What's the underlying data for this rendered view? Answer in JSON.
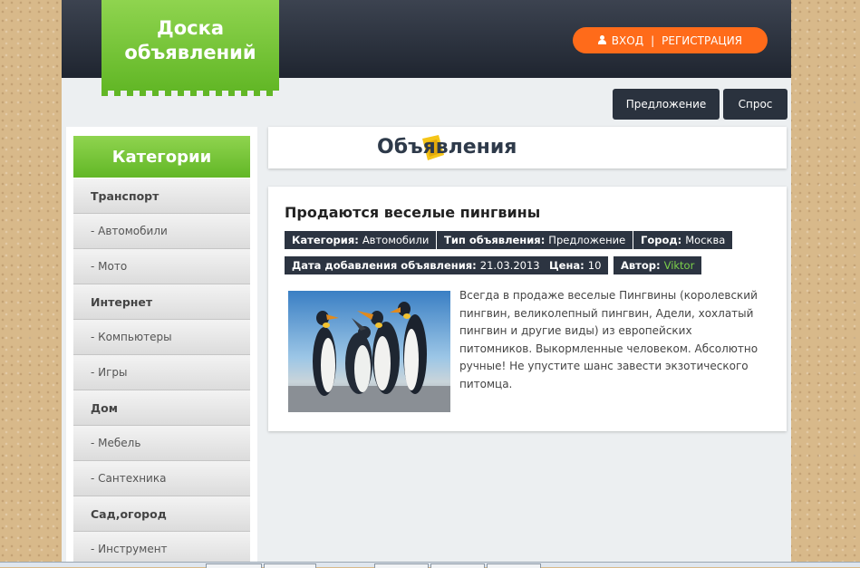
{
  "header": {
    "logo_line1": "Доска",
    "logo_line2": "объявлений",
    "login_label": "ВХОД",
    "separator": "|",
    "register_label": "РЕГИСТРАЦИЯ"
  },
  "nav": {
    "offer_label": "Предложение",
    "demand_label": "Спрос"
  },
  "sidebar": {
    "title": "Категории",
    "items": [
      {
        "label": "Транспорт"
      },
      {
        "label": "- Автомобили"
      },
      {
        "label": "- Мото"
      },
      {
        "label": "Интернет"
      },
      {
        "label": "- Компьютеры"
      },
      {
        "label": "- Игры"
      },
      {
        "label": "Дом"
      },
      {
        "label": "- Мебель"
      },
      {
        "label": "- Сантехника"
      },
      {
        "label": "Сад,огород"
      },
      {
        "label": "- Инструмент"
      }
    ]
  },
  "main": {
    "heading": "Объявления",
    "ad": {
      "title": "Продаются веселые пингвины",
      "category_label": "Категория:",
      "category_value": "Автомобили",
      "type_label": "Тип объявления:",
      "type_value": "Предложение",
      "city_label": "Город:",
      "city_value": "Москва",
      "date_label": "Дата добавления объявления:",
      "date_value": "21.03.2013",
      "price_label": "Цена:",
      "price_value": "10",
      "author_label": "Автор:",
      "author_value": "Viktor",
      "description": "Всегда в продаже веселые Пингвины (королевский пингвин, великолепный пингвин, Адели, хохлатый пингвин и другие виды) из европейских питомников. Выкормленные человеком. Абсолютно ручные! Не упустите шанс завести экзотического питомца."
    }
  },
  "colors": {
    "accent_green": "#6cc02f",
    "accent_orange": "#ff6b1a",
    "dark_navy": "#2a323e",
    "author_green": "#7cd14a"
  }
}
